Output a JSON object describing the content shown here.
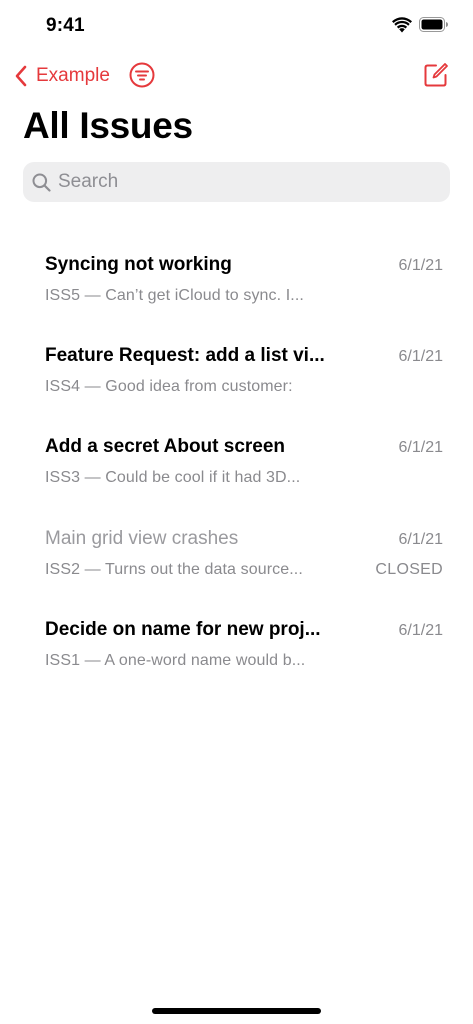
{
  "status_bar": {
    "time": "9:41"
  },
  "nav": {
    "back_label": "Example"
  },
  "header": {
    "title": "All Issues"
  },
  "search": {
    "placeholder": "Search",
    "value": ""
  },
  "colors": {
    "accent": "#e5393c",
    "secondary_text": "#8a8a8e"
  },
  "icons": [
    "wifi-icon",
    "battery-icon",
    "chevron-left-icon",
    "filter-icon",
    "compose-icon",
    "search-icon"
  ],
  "issues": [
    {
      "title": "Syncing not working",
      "subtitle": "ISS5 — Can’t get iCloud to sync. I...",
      "date": "6/1/21",
      "status": "",
      "closed": false
    },
    {
      "title": "Feature Request: add a list vi...",
      "subtitle": "ISS4 — Good idea from customer:",
      "date": "6/1/21",
      "status": "",
      "closed": false
    },
    {
      "title": "Add a secret About screen",
      "subtitle": "ISS3 — Could be cool if it had 3D...",
      "date": "6/1/21",
      "status": "",
      "closed": false
    },
    {
      "title": "Main grid view crashes",
      "subtitle": "ISS2 — Turns out the data source...",
      "date": "6/1/21",
      "status": "CLOSED",
      "closed": true
    },
    {
      "title": "Decide on name for new proj...",
      "subtitle": "ISS1 — A one-word name would b...",
      "date": "6/1/21",
      "status": "",
      "closed": false
    }
  ]
}
